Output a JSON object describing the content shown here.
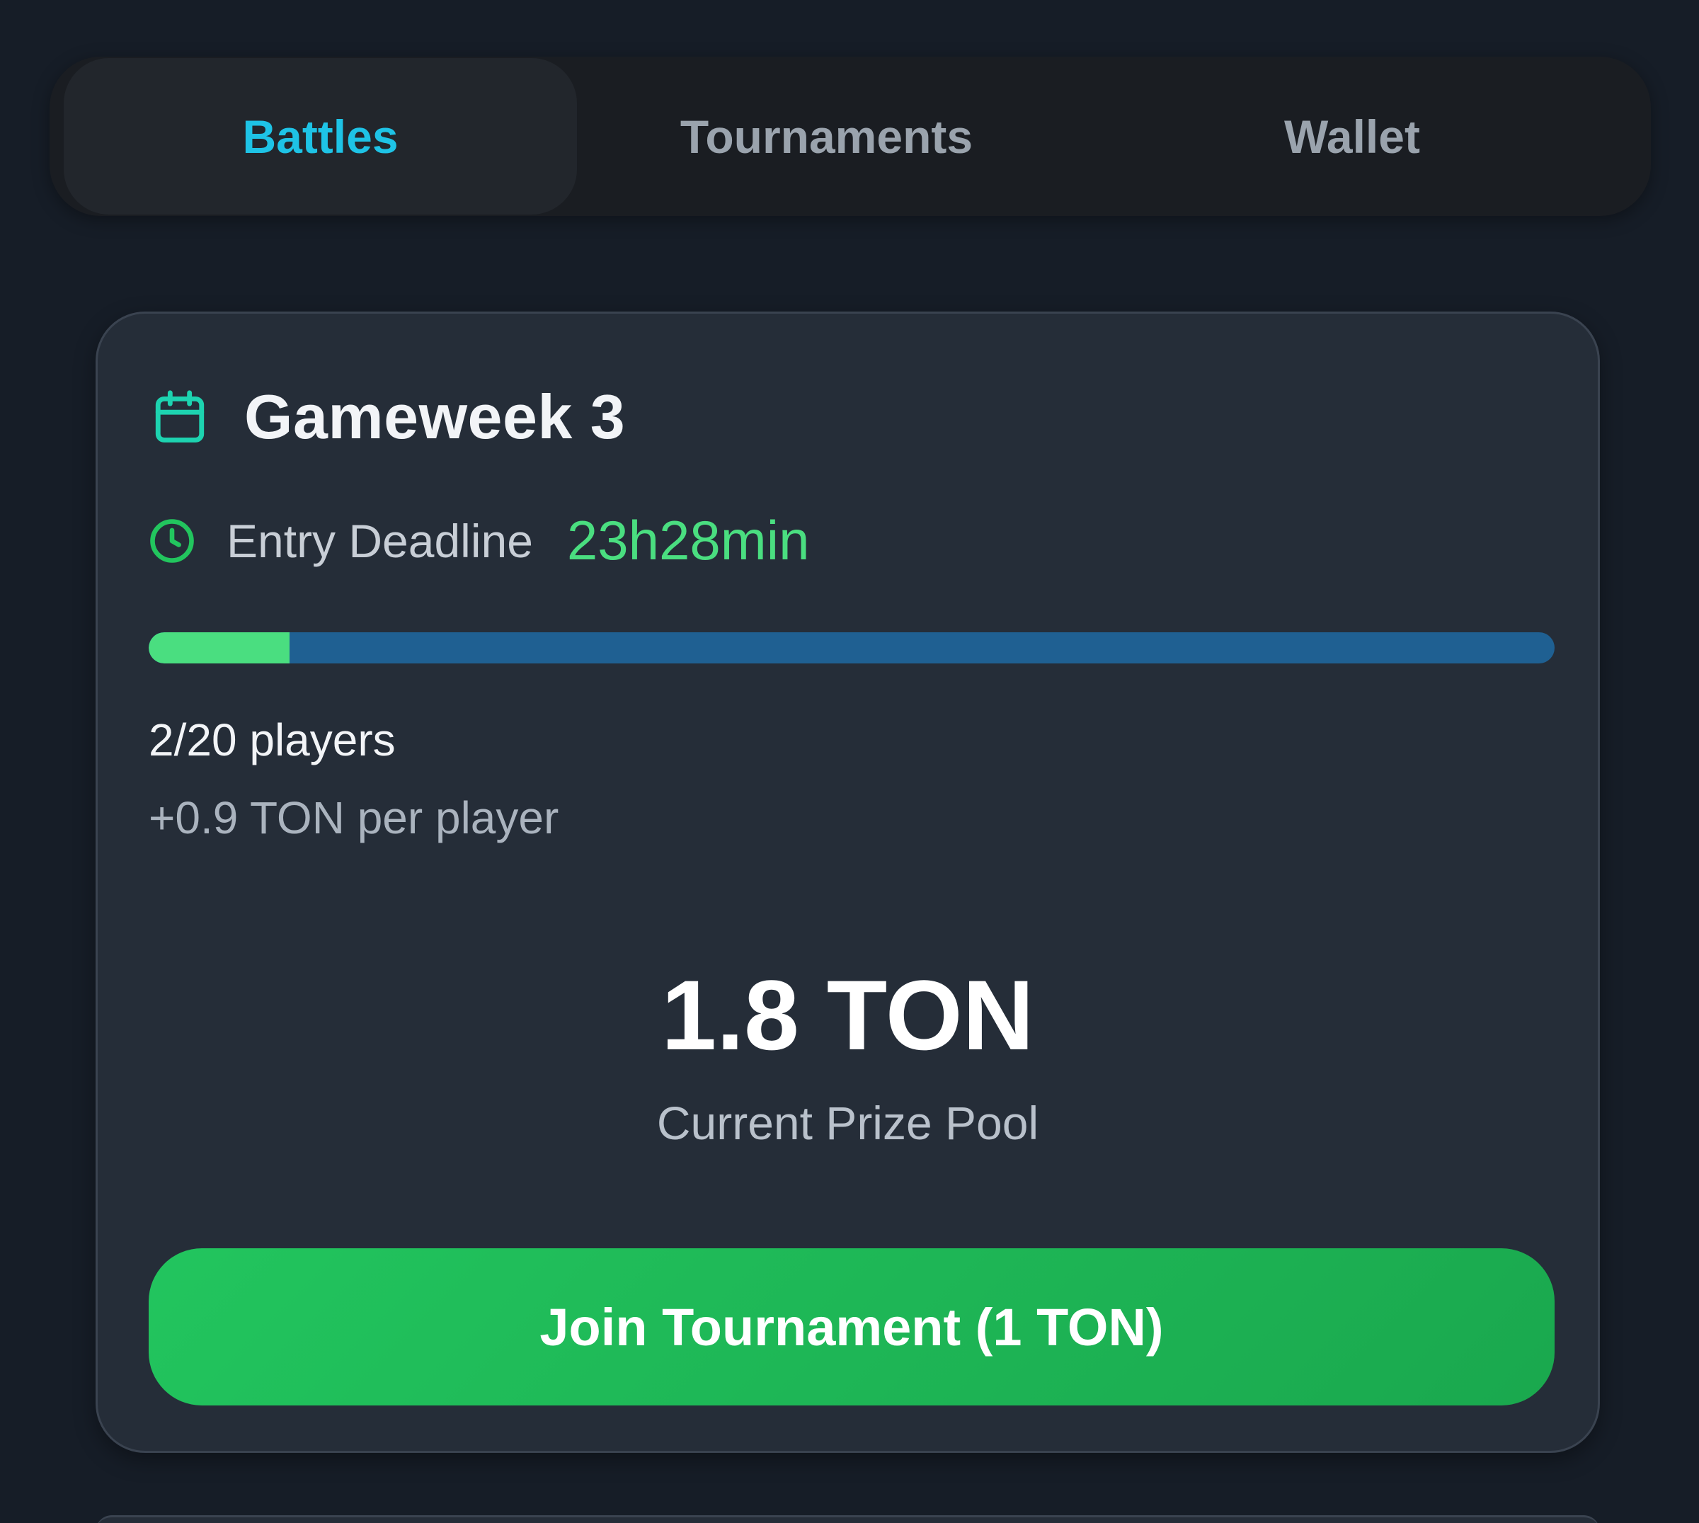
{
  "tabs": [
    {
      "label": "Battles",
      "active": true
    },
    {
      "label": "Tournaments",
      "active": false
    },
    {
      "label": "Wallet",
      "active": false
    }
  ],
  "card": {
    "title": "Gameweek 3",
    "deadline_label": "Entry Deadline",
    "deadline_value": "23h28min",
    "progress_fraction": 0.1,
    "players": "2/20 players",
    "per_player": "+0.9 TON per player",
    "prize_amount": "1.8 TON",
    "prize_label": "Current Prize Pool",
    "join_label": "Join Tournament (1 TON)"
  },
  "colors": {
    "accent_tab": "#1ec3e6",
    "green": "#4ade80",
    "button_green": "#22c55e",
    "progress_track": "#1f6092"
  }
}
